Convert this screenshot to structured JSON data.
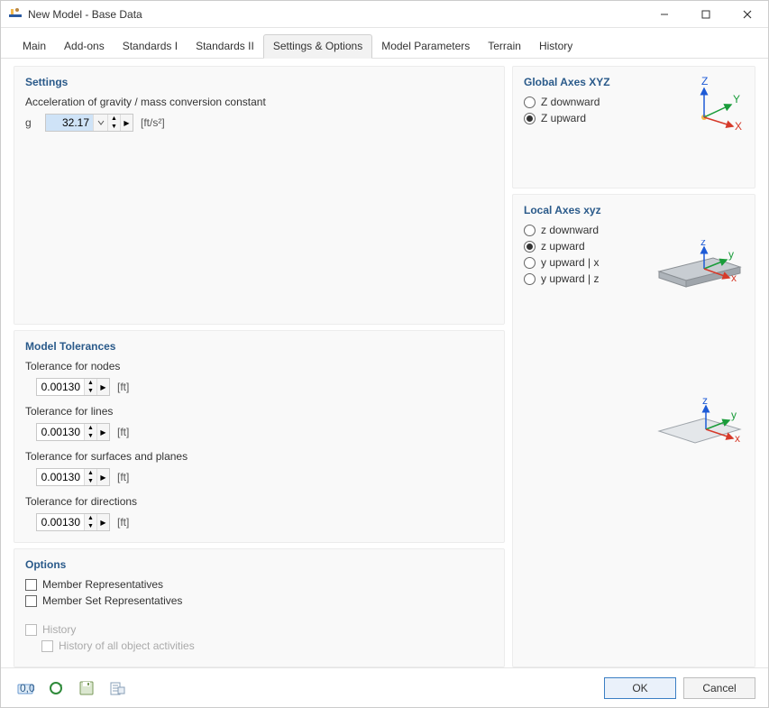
{
  "window": {
    "title": "New Model - Base Data"
  },
  "tabs": [
    "Main",
    "Add-ons",
    "Standards I",
    "Standards II",
    "Settings & Options",
    "Model Parameters",
    "Terrain",
    "History"
  ],
  "active_tab_index": 4,
  "settings": {
    "title": "Settings",
    "gravity_label": "Acceleration of gravity / mass conversion constant",
    "g_symbol": "g",
    "g_value": "32.17",
    "g_unit": "[ft/s²]"
  },
  "tolerances": {
    "title": "Model Tolerances",
    "items": [
      {
        "label": "Tolerance for nodes",
        "value": "0.00130",
        "unit": "[ft]"
      },
      {
        "label": "Tolerance for lines",
        "value": "0.00130",
        "unit": "[ft]"
      },
      {
        "label": "Tolerance for surfaces and planes",
        "value": "0.00130",
        "unit": "[ft]"
      },
      {
        "label": "Tolerance for directions",
        "value": "0.00130",
        "unit": "[ft]"
      }
    ]
  },
  "options": {
    "title": "Options",
    "checks": [
      {
        "label": "Member Representatives",
        "checked": false,
        "disabled": false
      },
      {
        "label": "Member Set Representatives",
        "checked": false,
        "disabled": false
      }
    ],
    "history": {
      "label": "History",
      "sub": "History of all object activities"
    }
  },
  "global_axes": {
    "title": "Global Axes XYZ",
    "options": [
      {
        "label": "Z downward",
        "checked": false
      },
      {
        "label": "Z upward",
        "checked": true
      }
    ]
  },
  "local_axes": {
    "title": "Local Axes xyz",
    "options": [
      {
        "label": "z downward",
        "checked": false
      },
      {
        "label": "z upward",
        "checked": true
      },
      {
        "label": "y upward | x",
        "checked": false
      },
      {
        "label": "y upward | z",
        "checked": false
      }
    ]
  },
  "footer": {
    "ok": "OK",
    "cancel": "Cancel"
  }
}
